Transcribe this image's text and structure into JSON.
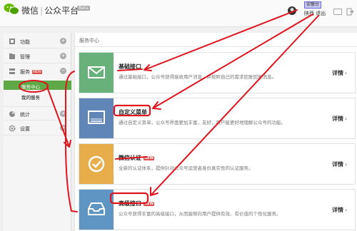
{
  "header": {
    "brand_name": "微信",
    "brand_section": "公众平台",
    "beta_badge": "Beta",
    "account_highlight": "安徽台",
    "user_name": "陕西  退出"
  },
  "sidebar": {
    "items": [
      {
        "label": "功能",
        "icon": "puzzle-icon"
      },
      {
        "label": "管理",
        "icon": "folder-icon"
      },
      {
        "label": "服务",
        "icon": "server-icon",
        "badge": "NEW"
      },
      {
        "label": "统计",
        "icon": "pie-chart-icon"
      },
      {
        "label": "设置",
        "icon": "gear-icon"
      }
    ],
    "sub_items": [
      {
        "label": "服务中心",
        "active": true
      },
      {
        "label": "我的服务",
        "active": false
      }
    ]
  },
  "main": {
    "title": "服务中心",
    "more_label": "详情",
    "cards": [
      {
        "title": "基础接口",
        "desc": "通过基础接口，公众号获得接收用户消息，并按照自己的需求回复回复消息。",
        "color": "#69b17a",
        "icon": "mail-icon"
      },
      {
        "title": "自定义菜单",
        "desc": "通过自定义菜单，公众号界面更加丰富，友好，用户能更好地理解公众号的功能。",
        "color": "#5f86b7",
        "icon": "menu-screen-icon"
      },
      {
        "title": "微信认证",
        "badge": "NEW",
        "desc": "全新的认证体系，提供针对公众号运营者身份真实性的认证服务。",
        "color": "#e6ad4a",
        "icon": "check-circle-icon"
      },
      {
        "title": "高级接口",
        "badge": "NEW",
        "desc": "公众号获得丰富的高级接口，从而能够向用户提供有效、有价值的个性化服务。",
        "color": "#5e95c2",
        "icon": "inbox-tray-icon"
      }
    ]
  },
  "colors": {
    "annotation_red": "#e0141e",
    "active_green": "#5fa847"
  }
}
